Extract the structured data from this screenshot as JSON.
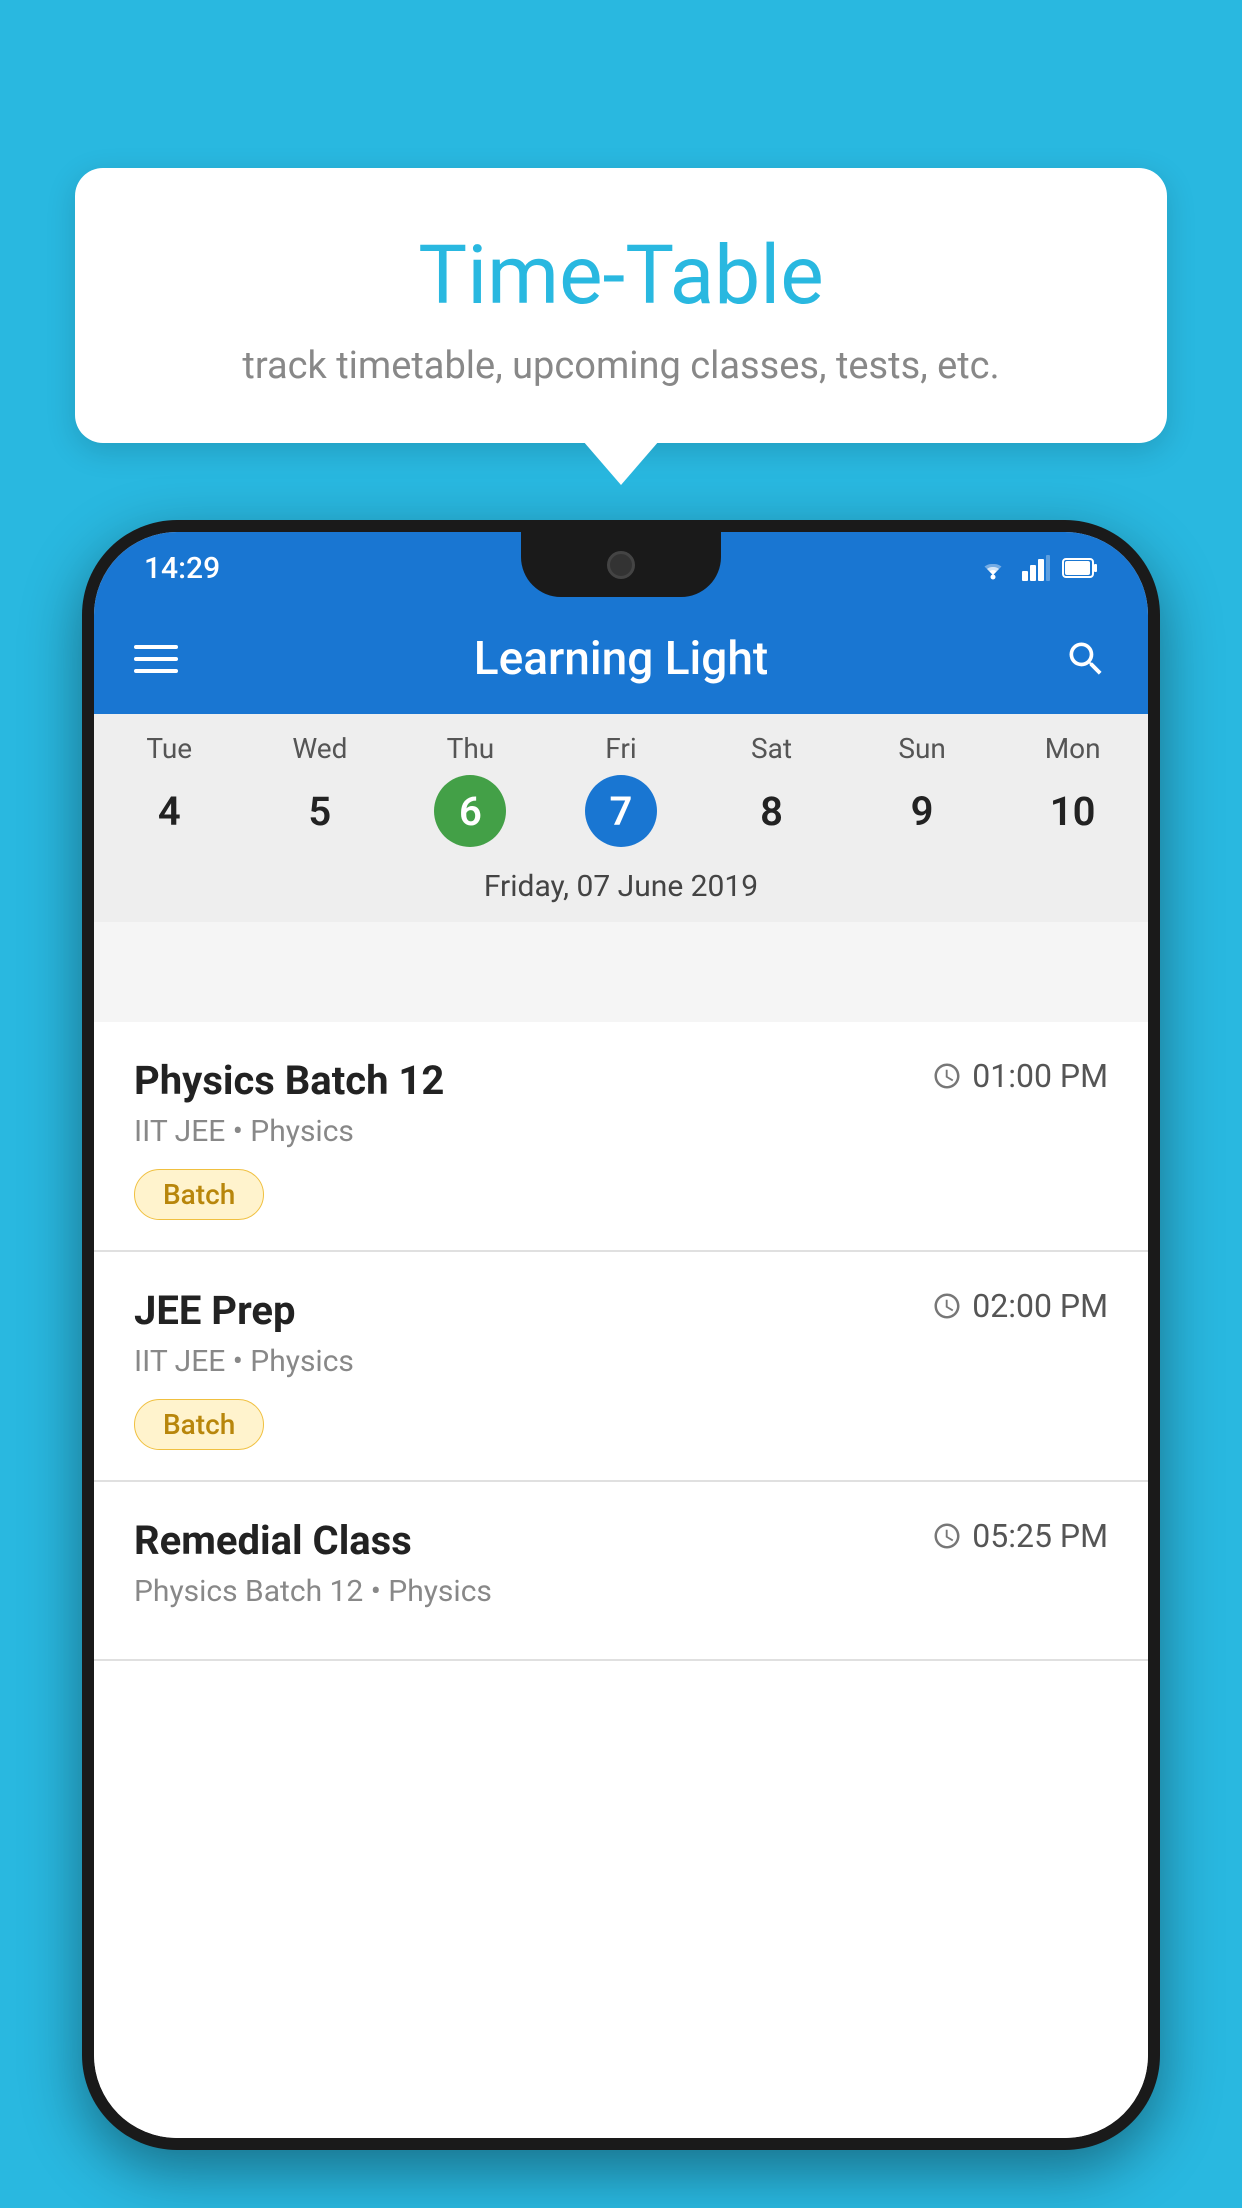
{
  "background_color": "#29b8e0",
  "tooltip": {
    "title": "Time-Table",
    "subtitle": "track timetable, upcoming classes, tests, etc."
  },
  "phone": {
    "status_bar": {
      "time": "14:29"
    },
    "header": {
      "title": "Learning Light"
    },
    "calendar": {
      "days": [
        {
          "label": "Tue",
          "number": "4",
          "state": "normal"
        },
        {
          "label": "Wed",
          "number": "5",
          "state": "normal"
        },
        {
          "label": "Thu",
          "number": "6",
          "state": "today"
        },
        {
          "label": "Fri",
          "number": "7",
          "state": "selected"
        },
        {
          "label": "Sat",
          "number": "8",
          "state": "normal"
        },
        {
          "label": "Sun",
          "number": "9",
          "state": "normal"
        },
        {
          "label": "Mon",
          "number": "10",
          "state": "normal"
        }
      ],
      "selected_date_label": "Friday, 07 June 2019"
    },
    "schedule": [
      {
        "title": "Physics Batch 12",
        "time": "01:00 PM",
        "meta": "IIT JEE • Physics",
        "badge": "Batch"
      },
      {
        "title": "JEE Prep",
        "time": "02:00 PM",
        "meta": "IIT JEE • Physics",
        "badge": "Batch"
      },
      {
        "title": "Remedial Class",
        "time": "05:25 PM",
        "meta": "Physics Batch 12 • Physics",
        "badge": null
      }
    ]
  }
}
